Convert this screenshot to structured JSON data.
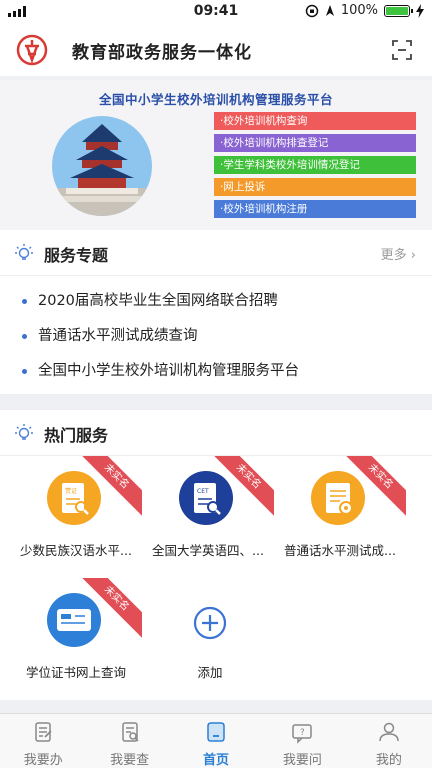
{
  "status": {
    "time": "09:41",
    "battery": "100%",
    "battery_level": 1.0
  },
  "header": {
    "title": "教育部政务服务一体化"
  },
  "banner": {
    "title": "全国中小学生校外培训机构管理服务平台",
    "items": [
      {
        "label": "·校外培训机构查询",
        "color": "#ef5b5b"
      },
      {
        "label": "·校外培训机构排查登记",
        "color": "#8a63d2"
      },
      {
        "label": "·学生学科类校外培训情况登记",
        "color": "#3ec03a"
      },
      {
        "label": "·网上投诉",
        "color": "#f39a2a"
      },
      {
        "label": "·校外培训机构注册",
        "color": "#4b7bd9"
      }
    ]
  },
  "topics": {
    "title": "服务专题",
    "more": "更多",
    "items": [
      "2020届高校毕业生全国网络联合招聘",
      "普通话水平测试成绩查询",
      "全国中小学生校外培训机构管理服务平台"
    ]
  },
  "hot": {
    "title": "热门服务",
    "tiles": [
      {
        "label": "少数民族汉语水平...",
        "ribbon": "未实名",
        "color": "#f5a623",
        "icon_label": "赞证"
      },
      {
        "label": "全国大学英语四、...",
        "ribbon": "未实名",
        "color": "#1e3f9a",
        "icon_label": "CET"
      },
      {
        "label": "普通话水平测试成...",
        "ribbon": "未实名",
        "color": "#f5a623",
        "icon_label": ""
      },
      {
        "label": "学位证书网上查询",
        "ribbon": "未实名",
        "color": "#2d7fd8",
        "icon_label": ""
      }
    ],
    "add_label": "添加"
  },
  "tabs": [
    {
      "label": "我要办",
      "active": false
    },
    {
      "label": "我要查",
      "active": false
    },
    {
      "label": "首页",
      "active": true
    },
    {
      "label": "我要问",
      "active": false
    },
    {
      "label": "我的",
      "active": false
    }
  ],
  "colors": {
    "accent": "#2a7fd4",
    "ribbon": "#e24e55",
    "bullet": "#3b6fd0"
  }
}
